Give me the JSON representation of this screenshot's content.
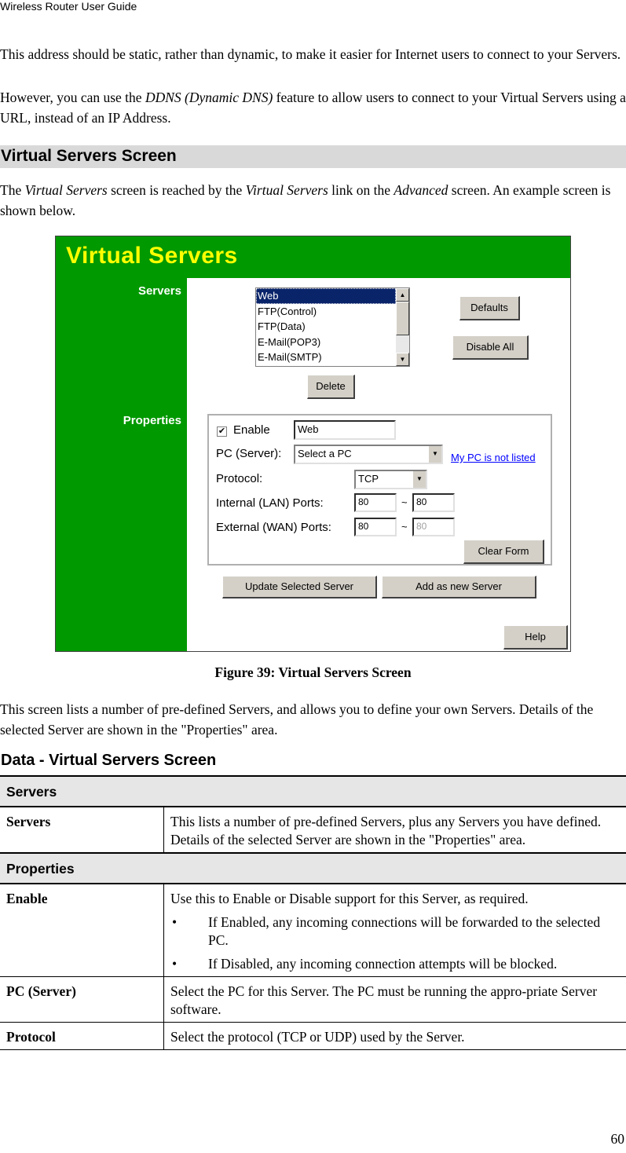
{
  "running_header": "Wireless Router User Guide",
  "intro": {
    "p1": "This address should be static, rather than dynamic, to make it easier for Internet users to connect to your Servers.",
    "p2_pre": "However, you can use the ",
    "p2_em": "DDNS (Dynamic DNS)",
    "p2_post": " feature to allow users to connect to your Virtual Servers using a URL, instead of an IP Address."
  },
  "section_heading": "Virtual Servers Screen",
  "section_intro": {
    "t1": "The ",
    "em1": "Virtual Servers",
    "t2": " screen is reached by the ",
    "em2": "Virtual Servers",
    "t3": " link on the ",
    "em3": "Advanced",
    "t4": " screen. An example screen is shown below."
  },
  "figure": {
    "title": "Virtual Servers",
    "servers_label": "Servers",
    "properties_label": "Properties",
    "server_list": [
      "Web",
      "FTP(Control)",
      "FTP(Data)",
      "E-Mail(POP3)",
      "E-Mail(SMTP)"
    ],
    "selected_server": "Web",
    "buttons": {
      "defaults": "Defaults",
      "disable_all": "Disable All",
      "delete": "Delete",
      "clear_form": "Clear Form",
      "update_selected": "Update Selected Server",
      "add_new": "Add as new Server",
      "help": "Help"
    },
    "properties": {
      "enable_label": "Enable",
      "enable_checked": true,
      "name_value": "Web",
      "pc_label": "PC (Server):",
      "pc_value": "Select a PC",
      "pc_link": "My PC is not listed",
      "protocol_label": "Protocol:",
      "protocol_value": "TCP",
      "lan_label": "Internal (LAN) Ports:",
      "lan_from": "80",
      "lan_to": "80",
      "wan_label": "External (WAN) Ports:",
      "wan_from": "80",
      "wan_to": "80",
      "range_sep": "~"
    },
    "colors": {
      "background": "#009900",
      "title": "#ffff00",
      "selection": "#0a246a"
    },
    "caption": "Figure 39: Virtual Servers Screen"
  },
  "after_figure": "This screen lists a number of pre-defined Servers, and allows you to define your own Servers. Details of the selected Server are shown in the \"Properties\" area.",
  "data_heading": "Data - Virtual Servers Screen",
  "table": {
    "sections": [
      {
        "title": "Servers",
        "rows": [
          {
            "field": "Servers",
            "desc": "This lists a number of pre-defined Servers, plus any Servers you have defined. Details of the selected Server are shown in the \"Properties\" area."
          }
        ]
      },
      {
        "title": "Properties",
        "rows": [
          {
            "field": "Enable",
            "desc": "Use this to Enable or Disable support for this Server, as required.",
            "bullets": [
              "If Enabled, any incoming connections will be forwarded to the selected PC.",
              "If Disabled, any incoming connection attempts will be blocked."
            ]
          },
          {
            "field": "PC (Server)",
            "desc": "Select the PC for this Server. The PC must be running the appro-priate Server software."
          },
          {
            "field": "Protocol",
            "desc": "Select the protocol (TCP or UDP) used by the Server."
          }
        ]
      }
    ]
  },
  "page_number": "60"
}
